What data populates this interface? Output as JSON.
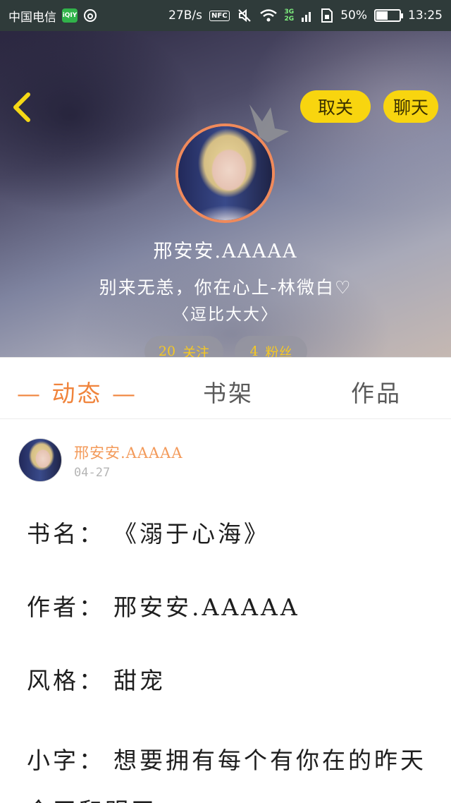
{
  "status_bar": {
    "carrier": "中国电信",
    "app_icon_label": "iQIY",
    "net_speed": "27B/s",
    "nfc_label": "NFC",
    "network_top": "3G",
    "network_bottom": "2G",
    "battery": "50%",
    "battery_level": 0.5,
    "time": "13:25"
  },
  "header": {
    "back_icon": "chevron-left-icon",
    "unfollow_label": "取关",
    "chat_label": "聊天",
    "user_name": "邢安安.AAAAA",
    "bio": "别来无恙，你在心上-林微白♡",
    "tag": "〈逗比大大〉",
    "follow_count": "20",
    "follow_label": "关注",
    "fans_count": "4",
    "fans_label": "粉丝",
    "accent_color": "#f8d50f"
  },
  "tabs": {
    "active": "— 动态 —",
    "shelf": "书架",
    "works": "作品",
    "active_color": "#f0843c"
  },
  "post": {
    "author": "邢安安.AAAAA",
    "date": "04-27",
    "lines": [
      {
        "label": "书名：",
        "value": "《溺于心海》"
      },
      {
        "label": "作者：",
        "value": "邢安安.AAAAA"
      },
      {
        "label": "风格：",
        "value": "甜宠"
      },
      {
        "label": "小字：",
        "value": "想要拥有每个有你在的昨天今天和明天"
      }
    ]
  }
}
